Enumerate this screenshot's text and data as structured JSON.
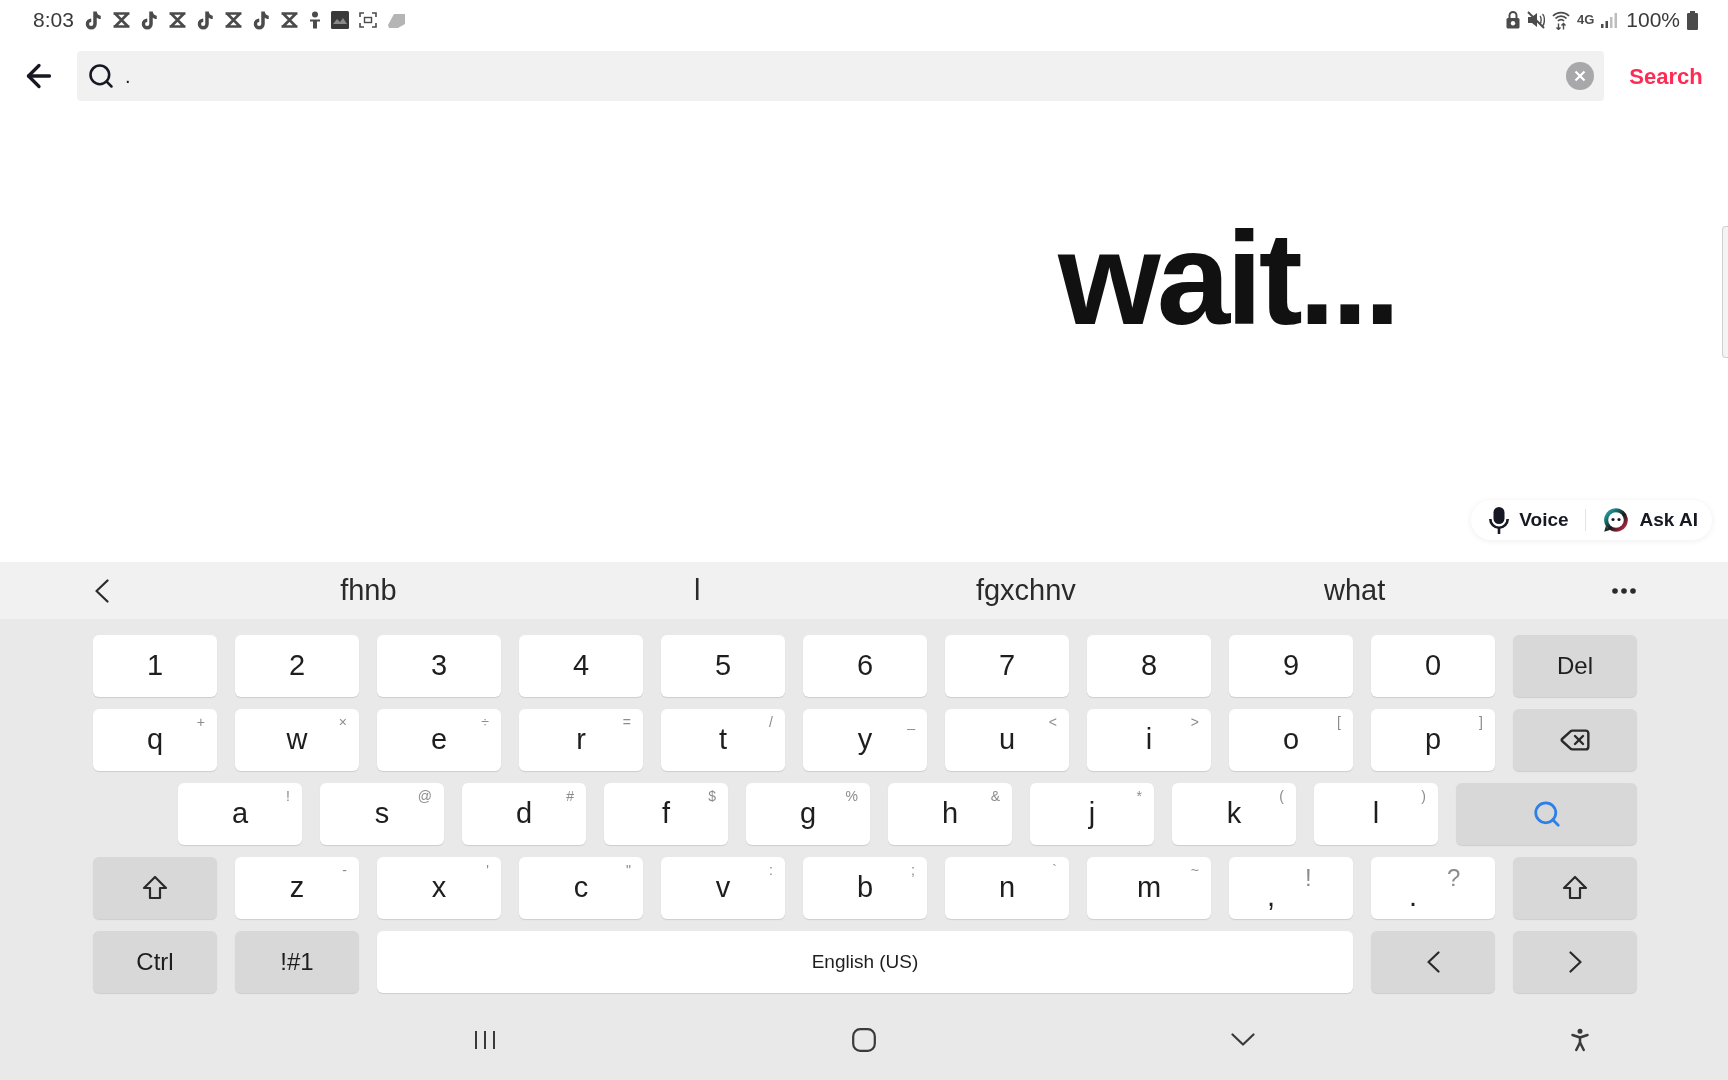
{
  "status_bar": {
    "time": "8:03",
    "network": "4G",
    "battery": "100%"
  },
  "search_bar": {
    "value": ".",
    "button": "Search"
  },
  "content": {
    "message": "wait..."
  },
  "actions": [
    {
      "kind": "voice",
      "label": "Voice"
    },
    {
      "kind": "ask_ai",
      "label": "Ask AI"
    }
  ],
  "keyboard": {
    "suggestions": [
      "fhnb",
      "l",
      "fgxchnv",
      "what"
    ],
    "rows": [
      {
        "keys": [
          {
            "kind": "char",
            "label": "1"
          },
          {
            "kind": "char",
            "label": "2"
          },
          {
            "kind": "char",
            "label": "3"
          },
          {
            "kind": "char",
            "label": "4"
          },
          {
            "kind": "char",
            "label": "5"
          },
          {
            "kind": "char",
            "label": "6"
          },
          {
            "kind": "char",
            "label": "7"
          },
          {
            "kind": "char",
            "label": "8"
          },
          {
            "kind": "char",
            "label": "9"
          },
          {
            "kind": "char",
            "label": "0"
          },
          {
            "kind": "function",
            "label": "Del"
          }
        ]
      },
      {
        "keys": [
          {
            "kind": "char",
            "label": "q",
            "alt": "+"
          },
          {
            "kind": "char",
            "label": "w",
            "alt": "×"
          },
          {
            "kind": "char",
            "label": "e",
            "alt": "÷"
          },
          {
            "kind": "char",
            "label": "r",
            "alt": "="
          },
          {
            "kind": "char",
            "label": "t",
            "alt": "/"
          },
          {
            "kind": "char",
            "label": "y",
            "alt": "_"
          },
          {
            "kind": "char",
            "label": "u",
            "alt": "<"
          },
          {
            "kind": "char",
            "label": "i",
            "alt": ">"
          },
          {
            "kind": "char",
            "label": "o",
            "alt": "["
          },
          {
            "kind": "char",
            "label": "p",
            "alt": "]"
          },
          {
            "kind": "backspace"
          }
        ]
      },
      {
        "keys": [
          {
            "kind": "char",
            "label": "a",
            "alt": "!"
          },
          {
            "kind": "char",
            "label": "s",
            "alt": "@"
          },
          {
            "kind": "char",
            "label": "d",
            "alt": "#"
          },
          {
            "kind": "char",
            "label": "f",
            "alt": "$"
          },
          {
            "kind": "char",
            "label": "g",
            "alt": "%"
          },
          {
            "kind": "char",
            "label": "h",
            "alt": "&"
          },
          {
            "kind": "char",
            "label": "j",
            "alt": "*"
          },
          {
            "kind": "char",
            "label": "k",
            "alt": "("
          },
          {
            "kind": "char",
            "label": "l",
            "alt": ")"
          },
          {
            "kind": "search"
          }
        ]
      },
      {
        "keys": [
          {
            "kind": "shift"
          },
          {
            "kind": "char",
            "label": "z",
            "alt": "-"
          },
          {
            "kind": "char",
            "label": "x",
            "alt": "'"
          },
          {
            "kind": "char",
            "label": "c",
            "alt": "\""
          },
          {
            "kind": "char",
            "label": "v",
            "alt": ":"
          },
          {
            "kind": "char",
            "label": "b",
            "alt": ";"
          },
          {
            "kind": "char",
            "label": "n",
            "alt": "`"
          },
          {
            "kind": "char",
            "label": "m",
            "alt": "~"
          },
          {
            "kind": "punct",
            "label": ",",
            "alt": "!"
          },
          {
            "kind": "punct",
            "label": ".",
            "alt": "?"
          },
          {
            "kind": "shift"
          }
        ]
      },
      {
        "keys": [
          {
            "kind": "function",
            "label": "Ctrl"
          },
          {
            "kind": "function",
            "label": "!#1"
          },
          {
            "kind": "space",
            "label": "English (US)"
          },
          {
            "kind": "cursor_left"
          },
          {
            "kind": "cursor_right"
          }
        ]
      }
    ]
  }
}
